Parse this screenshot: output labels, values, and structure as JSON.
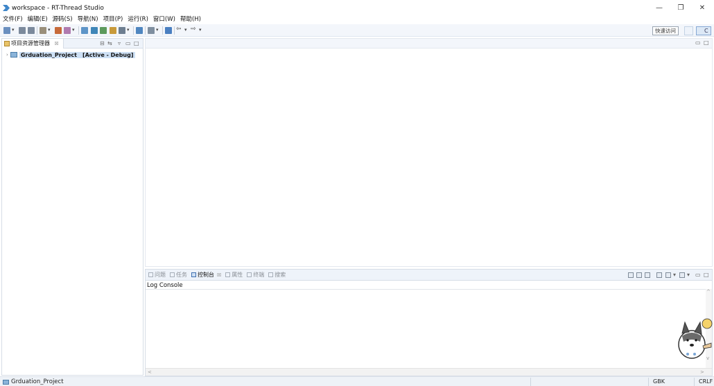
{
  "window": {
    "title": "workspace - RT-Thread Studio",
    "controls": {
      "minimize": "—",
      "maximize": "❐",
      "close": "✕"
    }
  },
  "menu": {
    "items": [
      "文件(F)",
      "编辑(E)",
      "源码(S)",
      "导航(N)",
      "项目(P)",
      "运行(R)",
      "窗口(W)",
      "帮助(H)"
    ]
  },
  "toolbar": {
    "quick_access_label": "快速访问",
    "perspective_c_label": "C"
  },
  "project_explorer": {
    "tab_label": "项目资源管理器",
    "tab_close": "☒",
    "project": {
      "name": "Grduation_Project",
      "status": "[Active - Debug]"
    }
  },
  "bottom_panel": {
    "tabs": [
      {
        "label": "问题",
        "active": false
      },
      {
        "label": "任务",
        "active": false
      },
      {
        "label": "控制台",
        "active": true
      },
      {
        "label": "属性",
        "active": false
      },
      {
        "label": "终端",
        "active": false
      },
      {
        "label": "搜索",
        "active": false
      }
    ],
    "tab_close": "☒",
    "console_title": "Log Console"
  },
  "status_bar": {
    "project": "Grduation_Project",
    "encoding": "GBK",
    "line_ending": "CRLF"
  },
  "colors": {
    "accent": "#3f6fb0",
    "selection": "#cde0f5",
    "toolbar_bg": "#f3f6fb"
  }
}
